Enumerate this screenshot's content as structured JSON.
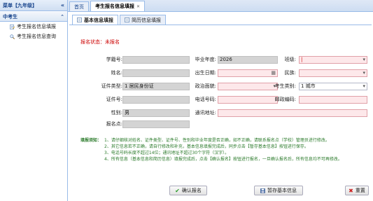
{
  "sidebar": {
    "title": "菜单【九年级】",
    "group": "中考生",
    "items": [
      {
        "label": "考生报名信息填报",
        "icon": "edit-form-icon"
      },
      {
        "label": "考生报名信息查询",
        "icon": "search-icon"
      }
    ]
  },
  "tabs": [
    {
      "label": "首页"
    },
    {
      "label": "考生报名信息填报"
    }
  ],
  "subtabs": [
    {
      "label": "基本信息填报"
    },
    {
      "label": "简历信息填报"
    }
  ],
  "status": "报名状态：未报名",
  "form": {
    "student_no": {
      "label": "学籍号:"
    },
    "grad_year": {
      "label": "毕业年度:",
      "value": "2026"
    },
    "class": {
      "label": "班级:",
      "value": "|"
    },
    "name": {
      "label": "姓名:"
    },
    "birth": {
      "label": "出生日期:"
    },
    "ethnicity": {
      "label": "民族:"
    },
    "id_type": {
      "label": "证件类型:",
      "value": "1 居民身份证"
    },
    "political": {
      "label": "政治面貌:"
    },
    "exam_type": {
      "label": "考生类别:",
      "value": "1  城市"
    },
    "id_no": {
      "label": "证件号:"
    },
    "phone": {
      "label": "电话号码:"
    },
    "postcode": {
      "label": "邮政编码:"
    },
    "gender": {
      "label": "性别:",
      "value": "男"
    },
    "address": {
      "label": "通讯地址:"
    },
    "exam_site": {
      "label": "报名点:"
    }
  },
  "notes": {
    "title": "填报须知：",
    "items": [
      "1、请仔细核对姓名、证件类型、证件号、性别和毕业年度是否正确，如不正确，请联系报名点（学校）管理员进行修改。",
      "2、其它信息若不正确，请自行修改和补充，基本信息填报完成后，同步点击【暂存基本信息】按钮进行保存。",
      "3、电话号码长度不超过14位；通讯地址不超过30个字符（汉字）。",
      "4、所有信息（基本信息和简历信息）填报完成后，点击【确认报名】按钮进行报名，一旦确认报名后，所有信息均不可再修改。"
    ]
  },
  "buttons": {
    "confirm": "确认报名",
    "save": "暂存基本信息",
    "reset": "重置"
  }
}
